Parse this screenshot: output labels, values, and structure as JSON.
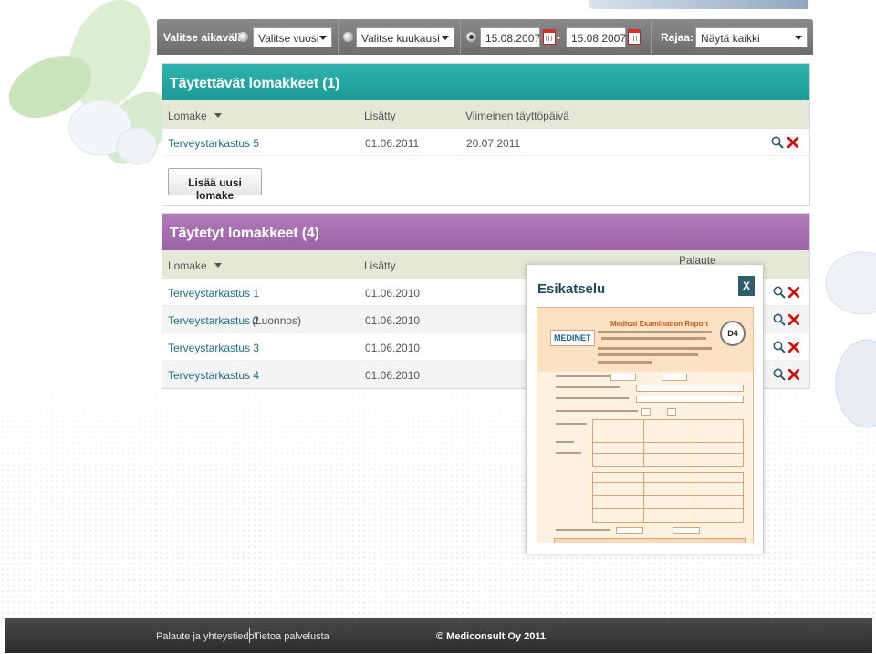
{
  "filter": {
    "range_label": "Valitse aikaväli:",
    "year_select": "Valitse vuosi",
    "month_select": "Valitse kuukausi",
    "date_from": "15.08.2007",
    "date_dash": "-",
    "date_to": "15.08.2007",
    "limit_label": "Rajaa:",
    "limit_select": "Näytä kaikki"
  },
  "to_fill": {
    "title": "Täytettävät lomakkeet (1)",
    "columns": {
      "form": "Lomake",
      "added": "Lisätty",
      "last_date": "Viimeinen täyttöpäivä"
    },
    "rows": [
      {
        "name": "Terveystarkastus 5",
        "added": "01.06.2011",
        "last_date": "20.07.2011"
      }
    ],
    "add_button": "Lisää uusi lomake"
  },
  "filled": {
    "title": "Täytetyt lomakkeet (4)",
    "columns": {
      "form": "Lomake",
      "added": "Lisätty",
      "feedback": "Palaute"
    },
    "rows": [
      {
        "name": "Terveystarkastus 1",
        "note": "",
        "added": "01.06.2010"
      },
      {
        "name": "Terveystarkastus 2",
        "note": "(Luonnos)",
        "added": "01.06.2010"
      },
      {
        "name": "Terveystarkastus 3",
        "note": "",
        "added": "01.06.2010"
      },
      {
        "name": "Terveystarkastus 4",
        "note": "",
        "added": "01.06.2010"
      }
    ]
  },
  "preview": {
    "title": "Esikatselu",
    "close": "X",
    "doc_brand": "MEDINET",
    "doc_title": "Medical Examination Report",
    "doc_badge": "D4"
  },
  "footer": {
    "feedback": "Palaute ja yhteystiedot",
    "about": "Tietoa palvelusta",
    "copyright": "© Mediconsult Oy 2011"
  },
  "colors": {
    "teal_header": "#1b9a96",
    "purple_header": "#9c62a6",
    "link": "#1d6f88",
    "delete": "#cc1111"
  }
}
